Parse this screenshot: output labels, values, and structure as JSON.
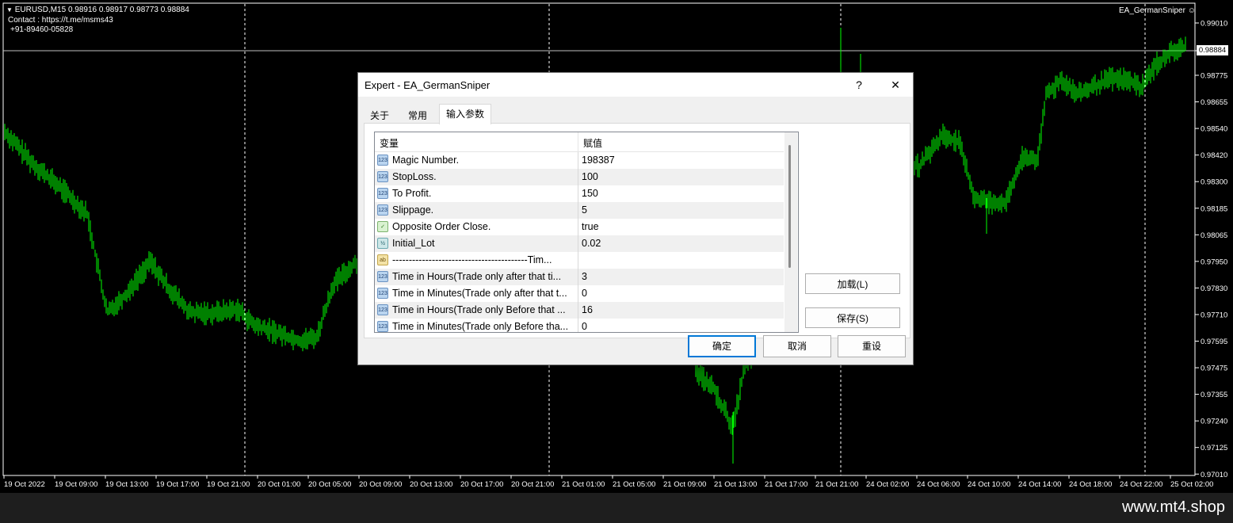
{
  "chart": {
    "symbol_line": "EURUSD,M15  0.98916 0.98917 0.98773 0.98884",
    "contact_line": "Contact : https://t.me/msms43",
    "phone_line": "+91-89460-05828",
    "ea_label": "EA_GermanSniper",
    "current_price": "0.98884",
    "candle_color": "#00ff00",
    "background": "#000000",
    "price_labels": [
      "0.99010",
      "0.98884",
      "0.98775",
      "0.98655",
      "0.98540",
      "0.98420",
      "0.98300",
      "0.98185",
      "0.98065",
      "0.97950",
      "0.97830",
      "0.97710",
      "0.97595",
      "0.97475",
      "0.97355",
      "0.97240",
      "0.97125",
      "0.97010"
    ],
    "time_labels": [
      "19 Oct 2022",
      "19 Oct 09:00",
      "19 Oct 13:00",
      "19 Oct 17:00",
      "19 Oct 21:00",
      "20 Oct 01:00",
      "20 Oct 05:00",
      "20 Oct 09:00",
      "20 Oct 13:00",
      "20 Oct 17:00",
      "20 Oct 21:00",
      "21 Oct 01:00",
      "21 Oct 05:00",
      "21 Oct 09:00",
      "21 Oct 13:00",
      "21 Oct 17:00",
      "21 Oct 21:00",
      "24 Oct 02:00",
      "24 Oct 06:00",
      "24 Oct 10:00",
      "24 Oct 14:00",
      "24 Oct 18:00",
      "24 Oct 22:00",
      "25 Oct 02:00"
    ]
  },
  "footer": {
    "brand": "www.mt4.shop"
  },
  "dialog": {
    "title": "Expert - EA_GermanSniper",
    "help_label": "?",
    "close_label": "✕",
    "tabs": [
      {
        "label": "关于"
      },
      {
        "label": "常用"
      },
      {
        "label": "输入参数"
      }
    ],
    "table": {
      "col_variable": "变量",
      "col_value": "赋值",
      "rows": [
        {
          "type": "int",
          "icon": "123",
          "name": "Magic Number.",
          "value": "198387"
        },
        {
          "type": "int",
          "icon": "123",
          "name": "StopLoss.",
          "value": "100"
        },
        {
          "type": "int",
          "icon": "123",
          "name": "To Profit.",
          "value": "150"
        },
        {
          "type": "int",
          "icon": "123",
          "name": "Slippage.",
          "value": "5"
        },
        {
          "type": "bool",
          "icon": "✓",
          "name": "Opposite Order Close.",
          "value": "true"
        },
        {
          "type": "dbl",
          "icon": "½",
          "name": "Initial_Lot",
          "value": "0.02"
        },
        {
          "type": "str",
          "icon": "ab",
          "name": "-----------------------------------------Tim...",
          "value": ""
        },
        {
          "type": "int",
          "icon": "123",
          "name": "Time in Hours(Trade only after that ti...",
          "value": "3"
        },
        {
          "type": "int",
          "icon": "123",
          "name": "Time in Minutes(Trade only after that t...",
          "value": "0"
        },
        {
          "type": "int",
          "icon": "123",
          "name": "Time in Hours(Trade only Before that ...",
          "value": "16"
        },
        {
          "type": "int",
          "icon": "123",
          "name": "Time in Minutes(Trade only Before tha...",
          "value": "0"
        }
      ]
    },
    "load_button": "加载(L)",
    "save_button": "保存(S)",
    "ok_button": "确定",
    "cancel_button": "取消",
    "reset_button": "重设"
  }
}
